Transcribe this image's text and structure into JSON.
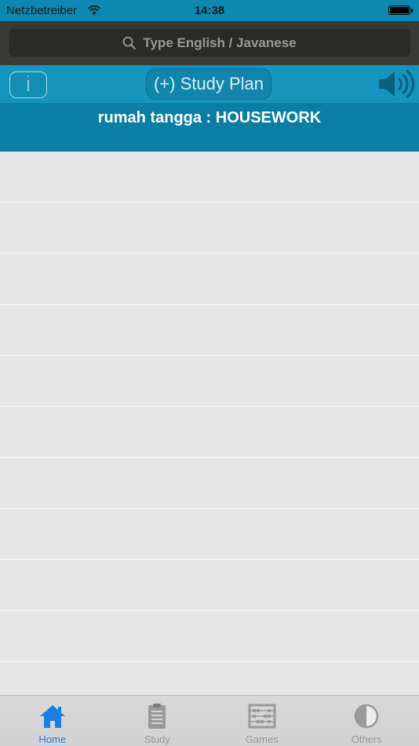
{
  "status_bar": {
    "carrier": "Netzbetreiber",
    "time": "14:38"
  },
  "search": {
    "placeholder": "Type English / Javanese"
  },
  "toolbar": {
    "info_label": "i",
    "study_plan_label": "(+) Study Plan"
  },
  "title": "rumah tangga : HOUSEWORK",
  "list": {
    "rows": [
      "",
      "",
      "",
      "",
      "",
      "",
      "",
      "",
      "",
      "",
      ""
    ]
  },
  "tabs": [
    {
      "label": "Home",
      "icon": "home-icon",
      "active": true
    },
    {
      "label": "Study",
      "icon": "clipboard-icon",
      "active": false
    },
    {
      "label": "Games",
      "icon": "abacus-icon",
      "active": false
    },
    {
      "label": "Others",
      "icon": "half-circle-icon",
      "active": false
    }
  ],
  "colors": {
    "status_bar": "#0b89b0",
    "toolbar": "#1695bc",
    "title_band": "#0a7ea4",
    "active_tab": "#1a7fe0",
    "inactive_tab": "#9a9a9a"
  }
}
